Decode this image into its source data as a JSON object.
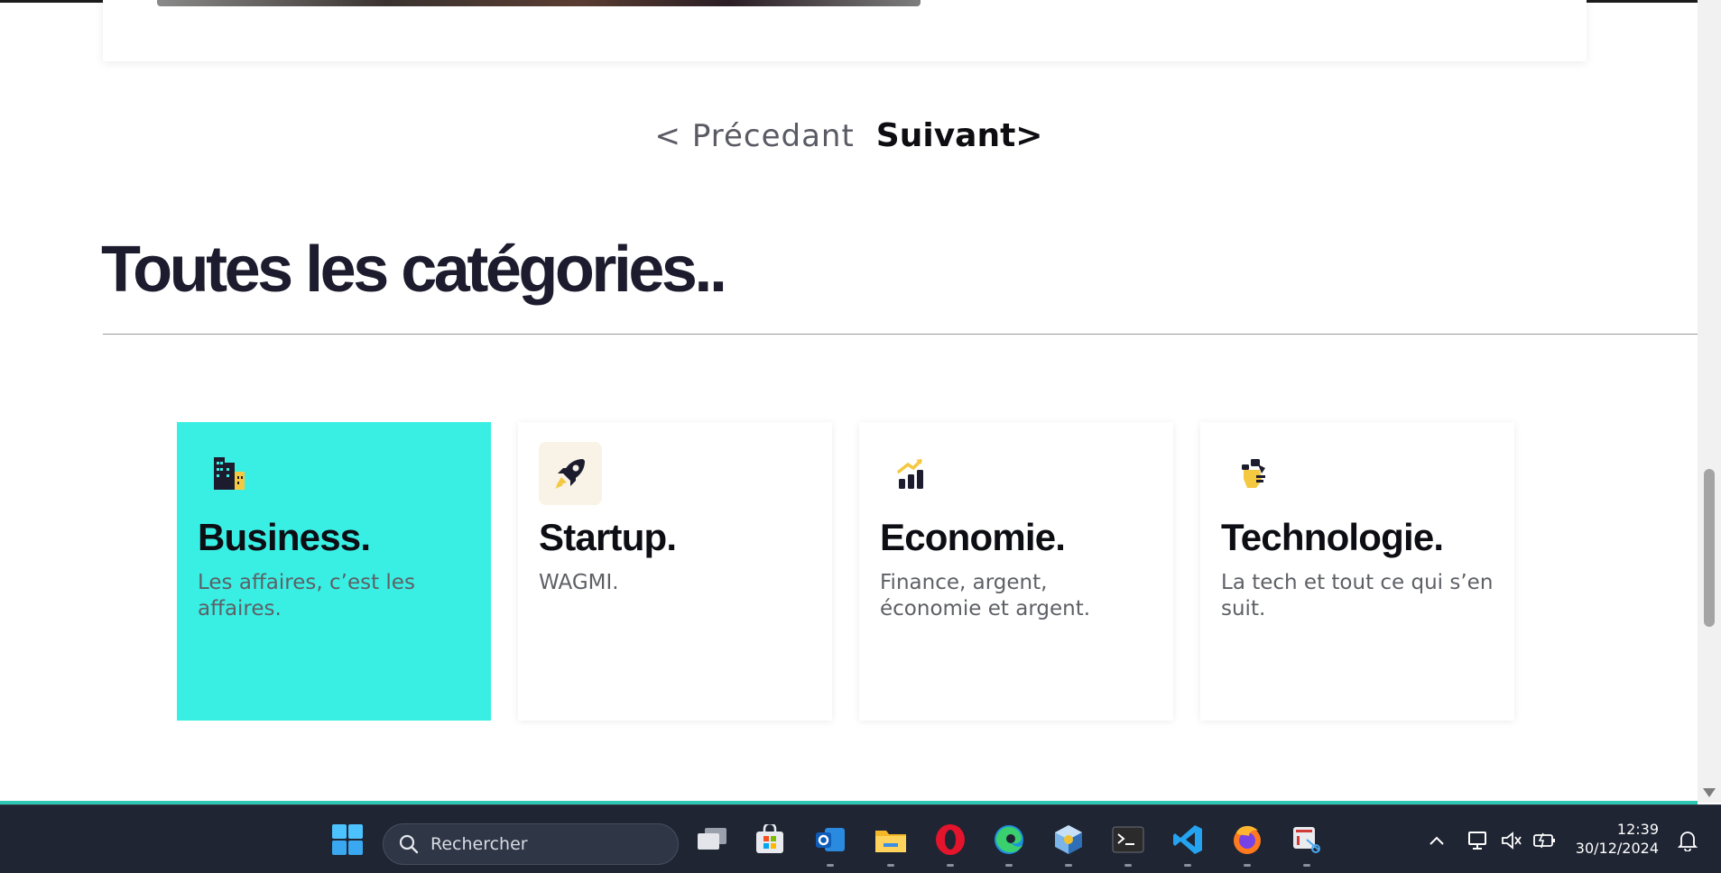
{
  "pagination": {
    "prev_label": "< Précedant",
    "next_label": "Suivant>"
  },
  "section": {
    "title": "Toutes les catégories.."
  },
  "categories": [
    {
      "title": "Business.",
      "description": "Les affaires, c’est les affaires.",
      "icon": "building-icon",
      "active": true
    },
    {
      "title": "Startup.",
      "description": "WAGMI.",
      "icon": "rocket-icon",
      "active": false
    },
    {
      "title": "Economie.",
      "description": "Finance, argent, économie et argent.",
      "icon": "growth-chart-icon",
      "active": false
    },
    {
      "title": "Technologie.",
      "description": "La tech et tout ce qui s’en suit.",
      "icon": "robot-hand-icon",
      "active": false
    }
  ],
  "colors": {
    "active_card": "#39efe4",
    "accent_yellow": "#f5c842",
    "dark": "#1d1c2e"
  },
  "taskbar": {
    "search_placeholder": "Rechercher",
    "apps": [
      "windows-start",
      "task-view",
      "microsoft-store",
      "outlook",
      "file-explorer",
      "opera",
      "edge",
      "virtualbox",
      "terminal",
      "vscode",
      "firefox",
      "snipping-tool"
    ],
    "time": "12:39",
    "date": "30/12/2024"
  }
}
